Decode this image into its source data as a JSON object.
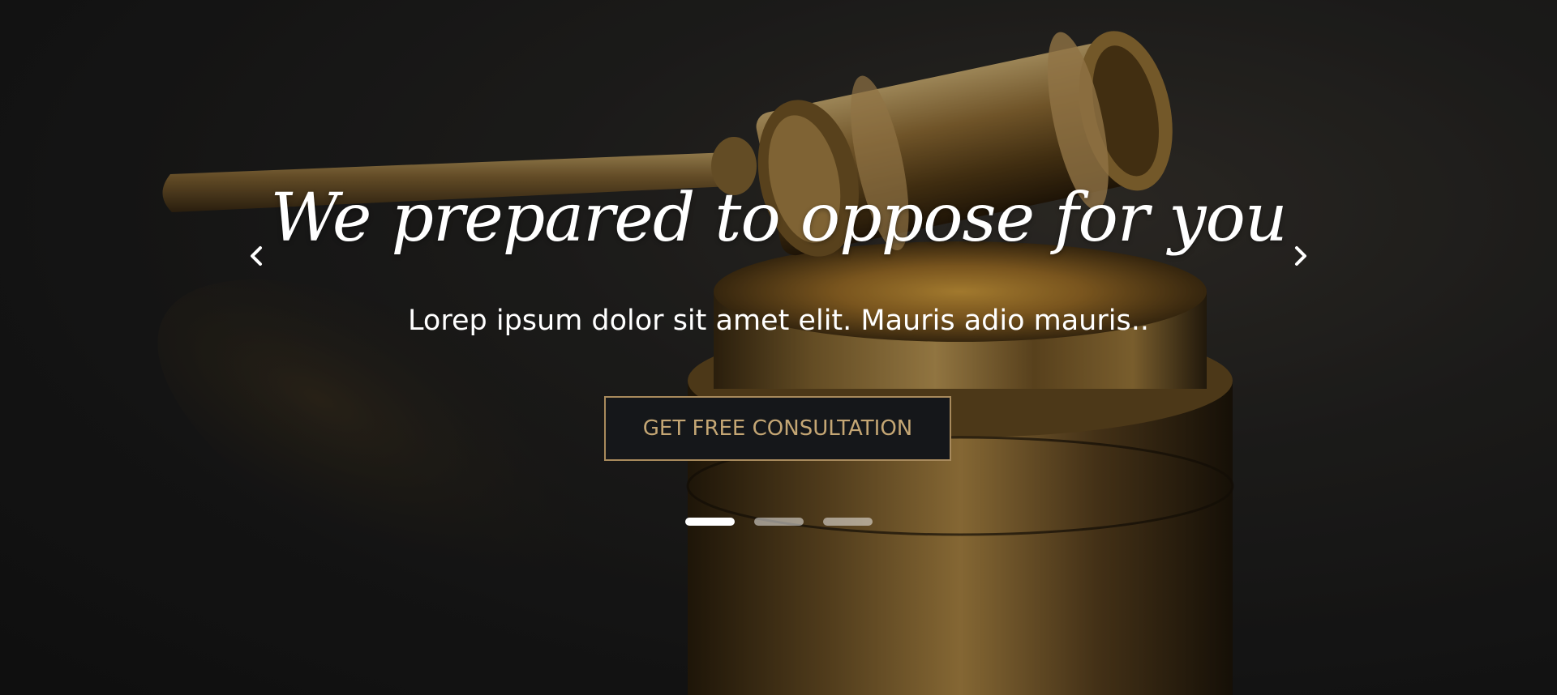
{
  "hero": {
    "headline": "We prepared to oppose for you",
    "subline": "Lorep ipsum dolor sit amet elit. Mauris adio mauris..",
    "cta_label": "GET FREE CONSULTATION"
  },
  "carousel": {
    "prev_icon": "chevron-left-icon",
    "next_icon": "chevron-right-icon",
    "slides": 3,
    "active_index": 0
  },
  "colors": {
    "accent_gold": "#c4a674",
    "cta_border": "#a88a5c",
    "cta_background": "#15171a",
    "text": "#ffffff"
  }
}
